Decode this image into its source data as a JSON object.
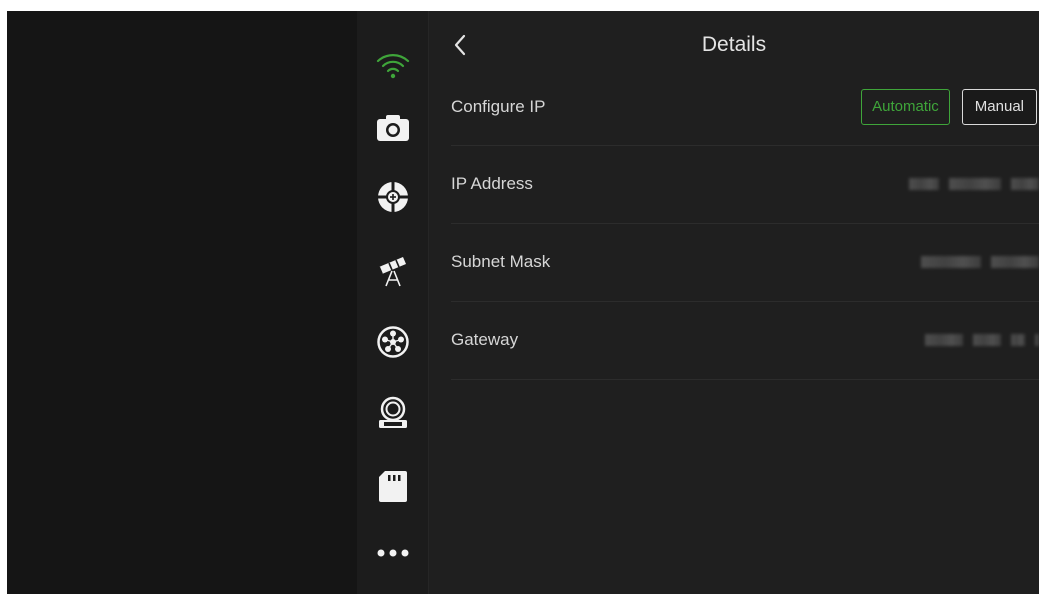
{
  "header": {
    "back_icon": "chevron-left-icon",
    "title": "Details"
  },
  "sidebar": {
    "items": [
      {
        "icon": "wifi-icon",
        "active": true
      },
      {
        "icon": "camera-icon",
        "active": false
      },
      {
        "icon": "crosshair-icon",
        "active": false
      },
      {
        "icon": "telescope-icon",
        "active": false
      },
      {
        "icon": "focuser-icon",
        "active": false
      },
      {
        "icon": "guide-camera-icon",
        "active": false
      },
      {
        "icon": "sd-card-icon",
        "active": false
      },
      {
        "icon": "more-icon",
        "active": false
      }
    ]
  },
  "settings": {
    "configure_ip": {
      "label": "Configure IP",
      "options": [
        "Automatic",
        "Manual"
      ],
      "selected": "Automatic"
    },
    "ip_address": {
      "label": "IP Address"
    },
    "subnet_mask": {
      "label": "Subnet Mask"
    },
    "gateway": {
      "label": "Gateway"
    }
  },
  "colors": {
    "accent": "#3fa53a",
    "background": "#1f1f1f",
    "sidebar": "#1c1c1c",
    "text": "#d6d6d6"
  }
}
